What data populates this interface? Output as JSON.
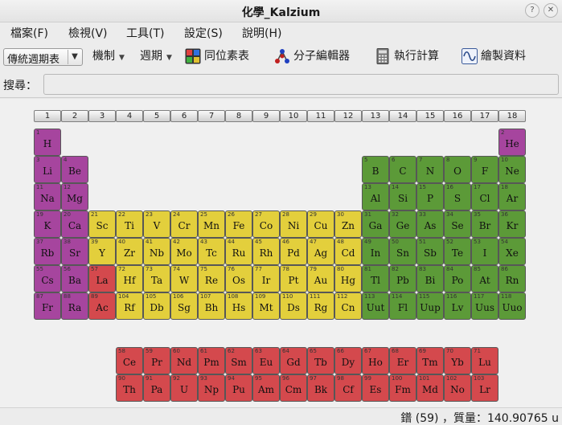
{
  "window": {
    "title": "化學_Kalzium",
    "help_btn": "?",
    "close_btn": "✕"
  },
  "menu": [
    "檔案(F)",
    "檢視(V)",
    "工具(T)",
    "設定(S)",
    "說明(H)"
  ],
  "toolbar": {
    "view_combo": "傳統週期表",
    "scheme": "機制",
    "period": "週期",
    "isotope": "同位素表",
    "molecule_editor": "分子編輯器",
    "calculator": "執行計算",
    "plot": "繪製資料"
  },
  "search": {
    "label": "搜尋：",
    "value": ""
  },
  "groups": [
    "1",
    "2",
    "3",
    "4",
    "5",
    "6",
    "7",
    "8",
    "9",
    "10",
    "11",
    "12",
    "13",
    "14",
    "15",
    "16",
    "17",
    "18"
  ],
  "elements": [
    {
      "n": 1,
      "s": "H",
      "k": "alk",
      "c": 1,
      "r": 1
    },
    {
      "n": 2,
      "s": "He",
      "k": "alk",
      "c": 18,
      "r": 1
    },
    {
      "n": 3,
      "s": "Li",
      "k": "alk",
      "c": 1,
      "r": 2
    },
    {
      "n": 4,
      "s": "Be",
      "k": "alk",
      "c": 2,
      "r": 2
    },
    {
      "n": 5,
      "s": "B",
      "k": "main",
      "c": 13,
      "r": 2
    },
    {
      "n": 6,
      "s": "C",
      "k": "main",
      "c": 14,
      "r": 2
    },
    {
      "n": 7,
      "s": "N",
      "k": "main",
      "c": 15,
      "r": 2
    },
    {
      "n": 8,
      "s": "O",
      "k": "main",
      "c": 16,
      "r": 2
    },
    {
      "n": 9,
      "s": "F",
      "k": "main",
      "c": 17,
      "r": 2
    },
    {
      "n": 10,
      "s": "Ne",
      "k": "main",
      "c": 18,
      "r": 2
    },
    {
      "n": 11,
      "s": "Na",
      "k": "alk",
      "c": 1,
      "r": 3
    },
    {
      "n": 12,
      "s": "Mg",
      "k": "alk",
      "c": 2,
      "r": 3
    },
    {
      "n": 13,
      "s": "Al",
      "k": "main",
      "c": 13,
      "r": 3
    },
    {
      "n": 14,
      "s": "Si",
      "k": "main",
      "c": 14,
      "r": 3
    },
    {
      "n": 15,
      "s": "P",
      "k": "main",
      "c": 15,
      "r": 3
    },
    {
      "n": 16,
      "s": "S",
      "k": "main",
      "c": 16,
      "r": 3
    },
    {
      "n": 17,
      "s": "Cl",
      "k": "main",
      "c": 17,
      "r": 3
    },
    {
      "n": 18,
      "s": "Ar",
      "k": "main",
      "c": 18,
      "r": 3
    },
    {
      "n": 19,
      "s": "K",
      "k": "alk",
      "c": 1,
      "r": 4
    },
    {
      "n": 20,
      "s": "Ca",
      "k": "alk",
      "c": 2,
      "r": 4
    },
    {
      "n": 21,
      "s": "Sc",
      "k": "tm",
      "c": 3,
      "r": 4
    },
    {
      "n": 22,
      "s": "Ti",
      "k": "tm",
      "c": 4,
      "r": 4
    },
    {
      "n": 23,
      "s": "V",
      "k": "tm",
      "c": 5,
      "r": 4
    },
    {
      "n": 24,
      "s": "Cr",
      "k": "tm",
      "c": 6,
      "r": 4
    },
    {
      "n": 25,
      "s": "Mn",
      "k": "tm",
      "c": 7,
      "r": 4
    },
    {
      "n": 26,
      "s": "Fe",
      "k": "tm",
      "c": 8,
      "r": 4
    },
    {
      "n": 27,
      "s": "Co",
      "k": "tm",
      "c": 9,
      "r": 4
    },
    {
      "n": 28,
      "s": "Ni",
      "k": "tm",
      "c": 10,
      "r": 4
    },
    {
      "n": 29,
      "s": "Cu",
      "k": "tm",
      "c": 11,
      "r": 4
    },
    {
      "n": 30,
      "s": "Zn",
      "k": "tm",
      "c": 12,
      "r": 4
    },
    {
      "n": 31,
      "s": "Ga",
      "k": "main",
      "c": 13,
      "r": 4
    },
    {
      "n": 32,
      "s": "Ge",
      "k": "main",
      "c": 14,
      "r": 4
    },
    {
      "n": 33,
      "s": "As",
      "k": "main",
      "c": 15,
      "r": 4
    },
    {
      "n": 34,
      "s": "Se",
      "k": "main",
      "c": 16,
      "r": 4
    },
    {
      "n": 35,
      "s": "Br",
      "k": "main",
      "c": 17,
      "r": 4
    },
    {
      "n": 36,
      "s": "Kr",
      "k": "main",
      "c": 18,
      "r": 4
    },
    {
      "n": 37,
      "s": "Rb",
      "k": "alk",
      "c": 1,
      "r": 5
    },
    {
      "n": 38,
      "s": "Sr",
      "k": "alk",
      "c": 2,
      "r": 5
    },
    {
      "n": 39,
      "s": "Y",
      "k": "tm",
      "c": 3,
      "r": 5
    },
    {
      "n": 40,
      "s": "Zr",
      "k": "tm",
      "c": 4,
      "r": 5
    },
    {
      "n": 41,
      "s": "Nb",
      "k": "tm",
      "c": 5,
      "r": 5
    },
    {
      "n": 42,
      "s": "Mo",
      "k": "tm",
      "c": 6,
      "r": 5
    },
    {
      "n": 43,
      "s": "Tc",
      "k": "tm",
      "c": 7,
      "r": 5
    },
    {
      "n": 44,
      "s": "Ru",
      "k": "tm",
      "c": 8,
      "r": 5
    },
    {
      "n": 45,
      "s": "Rh",
      "k": "tm",
      "c": 9,
      "r": 5
    },
    {
      "n": 46,
      "s": "Pd",
      "k": "tm",
      "c": 10,
      "r": 5
    },
    {
      "n": 47,
      "s": "Ag",
      "k": "tm",
      "c": 11,
      "r": 5
    },
    {
      "n": 48,
      "s": "Cd",
      "k": "tm",
      "c": 12,
      "r": 5
    },
    {
      "n": 49,
      "s": "In",
      "k": "main",
      "c": 13,
      "r": 5
    },
    {
      "n": 50,
      "s": "Sn",
      "k": "main",
      "c": 14,
      "r": 5
    },
    {
      "n": 51,
      "s": "Sb",
      "k": "main",
      "c": 15,
      "r": 5
    },
    {
      "n": 52,
      "s": "Te",
      "k": "main",
      "c": 16,
      "r": 5
    },
    {
      "n": 53,
      "s": "I",
      "k": "main",
      "c": 17,
      "r": 5
    },
    {
      "n": 54,
      "s": "Xe",
      "k": "main",
      "c": 18,
      "r": 5
    },
    {
      "n": 55,
      "s": "Cs",
      "k": "alk",
      "c": 1,
      "r": 6
    },
    {
      "n": 56,
      "s": "Ba",
      "k": "alk",
      "c": 2,
      "r": 6
    },
    {
      "n": 57,
      "s": "La",
      "k": "lan",
      "c": 3,
      "r": 6
    },
    {
      "n": 72,
      "s": "Hf",
      "k": "tm",
      "c": 4,
      "r": 6
    },
    {
      "n": 73,
      "s": "Ta",
      "k": "tm",
      "c": 5,
      "r": 6
    },
    {
      "n": 74,
      "s": "W",
      "k": "tm",
      "c": 6,
      "r": 6
    },
    {
      "n": 75,
      "s": "Re",
      "k": "tm",
      "c": 7,
      "r": 6
    },
    {
      "n": 76,
      "s": "Os",
      "k": "tm",
      "c": 8,
      "r": 6
    },
    {
      "n": 77,
      "s": "Ir",
      "k": "tm",
      "c": 9,
      "r": 6
    },
    {
      "n": 78,
      "s": "Pt",
      "k": "tm",
      "c": 10,
      "r": 6
    },
    {
      "n": 79,
      "s": "Au",
      "k": "tm",
      "c": 11,
      "r": 6
    },
    {
      "n": 80,
      "s": "Hg",
      "k": "tm",
      "c": 12,
      "r": 6
    },
    {
      "n": 81,
      "s": "Tl",
      "k": "main",
      "c": 13,
      "r": 6
    },
    {
      "n": 82,
      "s": "Pb",
      "k": "main",
      "c": 14,
      "r": 6
    },
    {
      "n": 83,
      "s": "Bi",
      "k": "main",
      "c": 15,
      "r": 6
    },
    {
      "n": 84,
      "s": "Po",
      "k": "main",
      "c": 16,
      "r": 6
    },
    {
      "n": 85,
      "s": "At",
      "k": "main",
      "c": 17,
      "r": 6
    },
    {
      "n": 86,
      "s": "Rn",
      "k": "main",
      "c": 18,
      "r": 6
    },
    {
      "n": 87,
      "s": "Fr",
      "k": "alk",
      "c": 1,
      "r": 7
    },
    {
      "n": 88,
      "s": "Ra",
      "k": "alk",
      "c": 2,
      "r": 7
    },
    {
      "n": 89,
      "s": "Ac",
      "k": "lan",
      "c": 3,
      "r": 7
    },
    {
      "n": 104,
      "s": "Rf",
      "k": "tm",
      "c": 4,
      "r": 7
    },
    {
      "n": 105,
      "s": "Db",
      "k": "tm",
      "c": 5,
      "r": 7
    },
    {
      "n": 106,
      "s": "Sg",
      "k": "tm",
      "c": 6,
      "r": 7
    },
    {
      "n": 107,
      "s": "Bh",
      "k": "tm",
      "c": 7,
      "r": 7
    },
    {
      "n": 108,
      "s": "Hs",
      "k": "tm",
      "c": 8,
      "r": 7
    },
    {
      "n": 109,
      "s": "Mt",
      "k": "tm",
      "c": 9,
      "r": 7
    },
    {
      "n": 110,
      "s": "Ds",
      "k": "tm",
      "c": 10,
      "r": 7
    },
    {
      "n": 111,
      "s": "Rg",
      "k": "tm",
      "c": 11,
      "r": 7
    },
    {
      "n": 112,
      "s": "Cn",
      "k": "tm",
      "c": 12,
      "r": 7
    },
    {
      "n": 113,
      "s": "Uut",
      "k": "main",
      "c": 13,
      "r": 7
    },
    {
      "n": 114,
      "s": "Fl",
      "k": "main",
      "c": 14,
      "r": 7
    },
    {
      "n": 115,
      "s": "Uup",
      "k": "main",
      "c": 15,
      "r": 7
    },
    {
      "n": 116,
      "s": "Lv",
      "k": "main",
      "c": 16,
      "r": 7
    },
    {
      "n": 117,
      "s": "Uus",
      "k": "main",
      "c": 17,
      "r": 7
    },
    {
      "n": 118,
      "s": "Uuo",
      "k": "main",
      "c": 18,
      "r": 7
    },
    {
      "n": 58,
      "s": "Ce",
      "k": "lan",
      "c": 4,
      "r": 9
    },
    {
      "n": 59,
      "s": "Pr",
      "k": "lan",
      "c": 5,
      "r": 9
    },
    {
      "n": 60,
      "s": "Nd",
      "k": "lan",
      "c": 6,
      "r": 9
    },
    {
      "n": 61,
      "s": "Pm",
      "k": "lan",
      "c": 7,
      "r": 9
    },
    {
      "n": 62,
      "s": "Sm",
      "k": "lan",
      "c": 8,
      "r": 9
    },
    {
      "n": 63,
      "s": "Eu",
      "k": "lan",
      "c": 9,
      "r": 9
    },
    {
      "n": 64,
      "s": "Gd",
      "k": "lan",
      "c": 10,
      "r": 9
    },
    {
      "n": 65,
      "s": "Tb",
      "k": "lan",
      "c": 11,
      "r": 9
    },
    {
      "n": 66,
      "s": "Dy",
      "k": "lan",
      "c": 12,
      "r": 9
    },
    {
      "n": 67,
      "s": "Ho",
      "k": "lan",
      "c": 13,
      "r": 9
    },
    {
      "n": 68,
      "s": "Er",
      "k": "lan",
      "c": 14,
      "r": 9
    },
    {
      "n": 69,
      "s": "Tm",
      "k": "lan",
      "c": 15,
      "r": 9
    },
    {
      "n": 70,
      "s": "Yb",
      "k": "lan",
      "c": 16,
      "r": 9
    },
    {
      "n": 71,
      "s": "Lu",
      "k": "lan",
      "c": 17,
      "r": 9
    },
    {
      "n": 90,
      "s": "Th",
      "k": "lan",
      "c": 4,
      "r": 10
    },
    {
      "n": 91,
      "s": "Pa",
      "k": "lan",
      "c": 5,
      "r": 10
    },
    {
      "n": 92,
      "s": "U",
      "k": "lan",
      "c": 6,
      "r": 10
    },
    {
      "n": 93,
      "s": "Np",
      "k": "lan",
      "c": 7,
      "r": 10
    },
    {
      "n": 94,
      "s": "Pu",
      "k": "lan",
      "c": 8,
      "r": 10
    },
    {
      "n": 95,
      "s": "Am",
      "k": "lan",
      "c": 9,
      "r": 10
    },
    {
      "n": 96,
      "s": "Cm",
      "k": "lan",
      "c": 10,
      "r": 10
    },
    {
      "n": 97,
      "s": "Bk",
      "k": "lan",
      "c": 11,
      "r": 10
    },
    {
      "n": 98,
      "s": "Cf",
      "k": "lan",
      "c": 12,
      "r": 10
    },
    {
      "n": 99,
      "s": "Es",
      "k": "lan",
      "c": 13,
      "r": 10
    },
    {
      "n": 100,
      "s": "Fm",
      "k": "lan",
      "c": 14,
      "r": 10
    },
    {
      "n": 101,
      "s": "Md",
      "k": "lan",
      "c": 15,
      "r": 10
    },
    {
      "n": 102,
      "s": "No",
      "k": "lan",
      "c": 16,
      "r": 10
    },
    {
      "n": 103,
      "s": "Lr",
      "k": "lan",
      "c": 17,
      "r": 10
    }
  ],
  "category_colors": {
    "alk": "#a6459e",
    "tm": "#e3cf3c",
    "main": "#5c9a38",
    "lan": "#d4494d"
  },
  "status": "鐠 (59) ，質量：140.90765 u"
}
